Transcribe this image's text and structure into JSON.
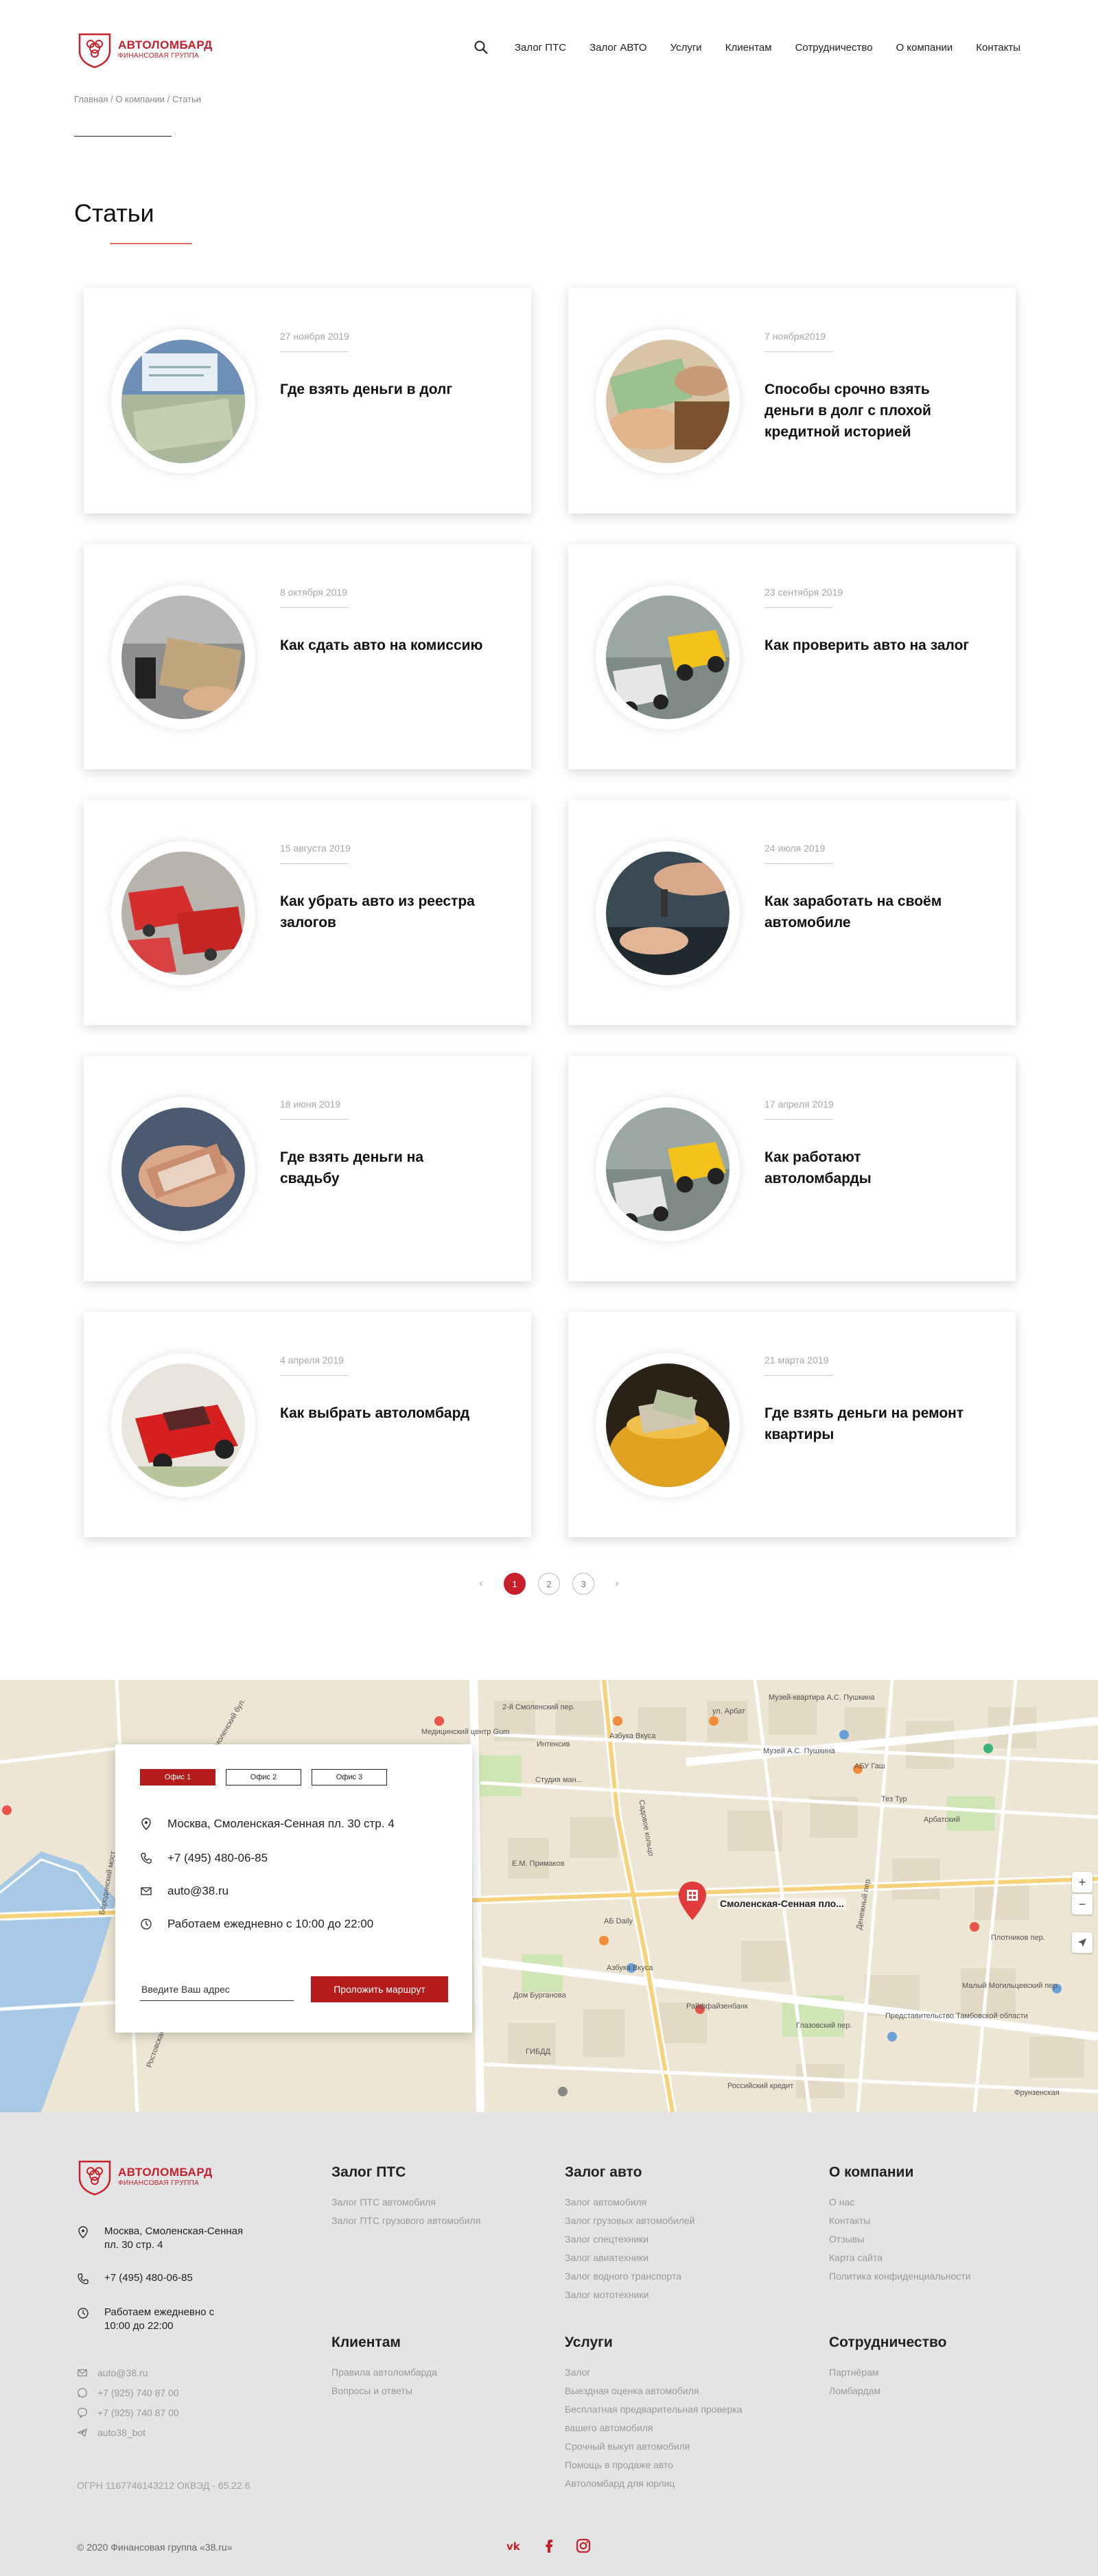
{
  "header": {
    "logo_title": "АВТОЛОМБАРД",
    "logo_sub": "ФИНАНСОВАЯ ГРУППА",
    "nav": [
      "Залог ПТС",
      "Залог АВТО",
      "Услуги",
      "Клиентам",
      "Сотрудничество",
      "О компании",
      "Контакты"
    ]
  },
  "breadcrumb": [
    "Главная",
    "О компании",
    "Статьи"
  ],
  "page_title": "Статьи",
  "articles": [
    {
      "date": "27 ноября 2019",
      "title": "Где взять деньги в долг",
      "image": "money-contract"
    },
    {
      "date": "7 ноября2019",
      "title": "Способы срочно взять деньги в долг с плохой кредитной историей",
      "image": "money-hands"
    },
    {
      "date": "8 октября 2019",
      "title": "Как сдать авто на комиссию",
      "image": "car-money"
    },
    {
      "date": "23 сентября 2019",
      "title": "Как проверить авто на залог",
      "image": "toy-cars-cash"
    },
    {
      "date": "15 августа 2019",
      "title": "Как убрать авто из реестра залогов",
      "image": "red-cars"
    },
    {
      "date": "24 июля 2019",
      "title": "Как заработать на своём автомобиле",
      "image": "car-keys"
    },
    {
      "date": "18 июня 2019",
      "title": "Где взять деньги на свадьбу",
      "image": "counting-cash"
    },
    {
      "date": "17 апреля 2019",
      "title": "Как работают автоломбарды",
      "image": "toy-cars-cash"
    },
    {
      "date": "4 апреля 2019",
      "title": "Как выбрать автоломбард",
      "image": "red-toy-car"
    },
    {
      "date": "21 марта 2019",
      "title": "Где взять деньги на ремонт квартиры",
      "image": "money-jar"
    }
  ],
  "pagination": {
    "prev": "‹",
    "next": "›",
    "pages": [
      "1",
      "2",
      "3"
    ],
    "current": "1"
  },
  "map": {
    "labels": [
      "Медицинский центр Gum",
      "2-й Смоленский пер.",
      "Азбука Вкуса",
      "Музей-квартира А.С. Пушкина",
      "ул. Арбат",
      "Интенсив",
      "Студия ман...",
      "Музей А.С. Пушкина",
      "АБУ Гаш",
      "Тез Тур",
      "Арбатский",
      "Садовое кольцо",
      "Е.М. Примаков",
      "АБ Daily",
      "Азбука Вкуса",
      "Дом Бурганова",
      "Ростовская наб.",
      "Бородинский мост",
      "Смоленский бул.",
      "Глазовский пер.",
      "Малый Могильцевский пер.",
      "Представительство Тамбовской области",
      "Российский кредит",
      "Денежный пер.",
      "Плотников пер.",
      "Фрунзенская",
      "Райффайзенбанк",
      "ГИБДД"
    ],
    "marker_label": "Смоленская-Сенная пло...",
    "zoom_in": "+",
    "zoom_out": "−"
  },
  "office": {
    "tabs": [
      "Офис 1",
      "Офис 2",
      "Офис 3"
    ],
    "active_tab": "Офис 1",
    "address": "Москва, Смоленская-Сенная пл. 30 стр. 4",
    "phone": "+7 (495) 480-06-85",
    "email": "auto@38.ru",
    "hours": "Работаем ежедневно с 10:00 до 22:00",
    "address_placeholder": "Введите Ваш адрес",
    "route_button": "Проложить маршрут"
  },
  "footer": {
    "address": "Москва, Смоленская-Сенная пл. 30 стр. 4",
    "phone": "+7 (495) 480-06-85",
    "hours": "Работаем ежедневно с 10:00 до 22:00",
    "email": "auto@38.ru",
    "whatsapp": "+7 (925) 740 87 00",
    "viber": "+7 (925) 740 87 00",
    "telegram": "auto38_bot",
    "legal": "ОГРН 1167746143212 ОКВЭД - 65.22.6",
    "copyright": "© 2020 Финансовая группа «38.ru»",
    "columns": [
      {
        "title": "Залог ПТС",
        "links": [
          "Залог ПТС автомобиля",
          "Залог ПТС грузового автомобиля"
        ]
      },
      {
        "title": "Залог авто",
        "links": [
          "Залог автомобиля",
          "Залог грузовых автомобилей",
          "Залог спецтехники",
          "Залог авиатехники",
          "Залог водного транспорта",
          "Залог мототехники"
        ]
      },
      {
        "title": "О компании",
        "links": [
          "О нас",
          "Контакты",
          "Отзывы",
          "Карта сайта",
          "Политика конфиденциальности"
        ]
      },
      {
        "title": "Клиентам",
        "links": [
          "Правила автоломбарда",
          "Вопросы и ответы"
        ]
      },
      {
        "title": "Услуги",
        "links": [
          "Залог",
          "Выездная оценка автомобиля",
          "Бесплатная предварительная проверка",
          "вашего автомобиля",
          "Срочный выкуп автомобиля",
          "Помощь в продаже авто",
          "Автоломбард для юрлиц"
        ]
      },
      {
        "title": "Сотрудничество",
        "links": [
          "Партнёрам",
          "Ломбардам"
        ]
      }
    ],
    "socials": [
      "vk-icon",
      "facebook-icon",
      "instagram-icon"
    ]
  },
  "colors": {
    "accent": "#c8202a",
    "button": "#b71c1c",
    "footer_bg": "#e4e4e4"
  }
}
